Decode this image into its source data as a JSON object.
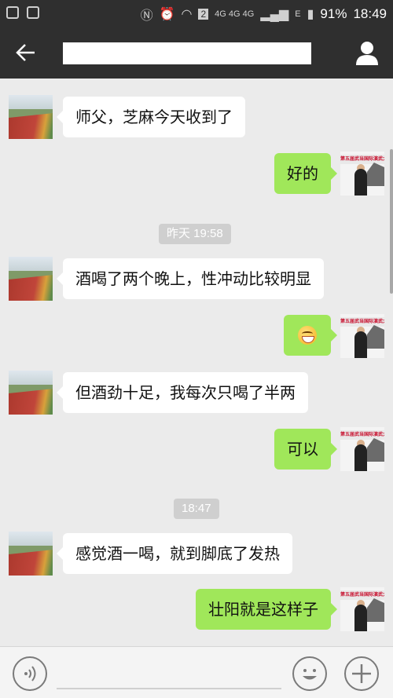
{
  "status_bar": {
    "network_small": "4G 4G 4G",
    "sim_label": "2",
    "e_label": "E",
    "battery": "91%",
    "time": "18:49"
  },
  "header": {
    "title": "",
    "back_icon": "arrow-left-icon",
    "profile_icon": "person-icon"
  },
  "timestamps": {
    "t1": "昨天 19:58",
    "t2": "18:47"
  },
  "messages": [
    {
      "side": "left",
      "text": "师父，芝麻今天收到了"
    },
    {
      "side": "right",
      "text": "好的"
    },
    {
      "side": "left",
      "text": "酒喝了两个晚上，性冲动比较明显"
    },
    {
      "side": "right",
      "text": "",
      "emoji": "grinning-emoji"
    },
    {
      "side": "left",
      "text": "但酒劲十足，我每次只喝了半两"
    },
    {
      "side": "right",
      "text": "可以"
    },
    {
      "side": "left",
      "text": "感觉酒一喝，就到脚底了发热"
    },
    {
      "side": "right",
      "text": "壮阳就是这样子"
    }
  ],
  "avatar_right": {
    "banner": "第五届武当国际演武大"
  },
  "input_bar": {
    "placeholder": "",
    "voice_icon": "voice-icon",
    "emoji_icon": "smiley-icon",
    "plus_icon": "plus-icon"
  }
}
